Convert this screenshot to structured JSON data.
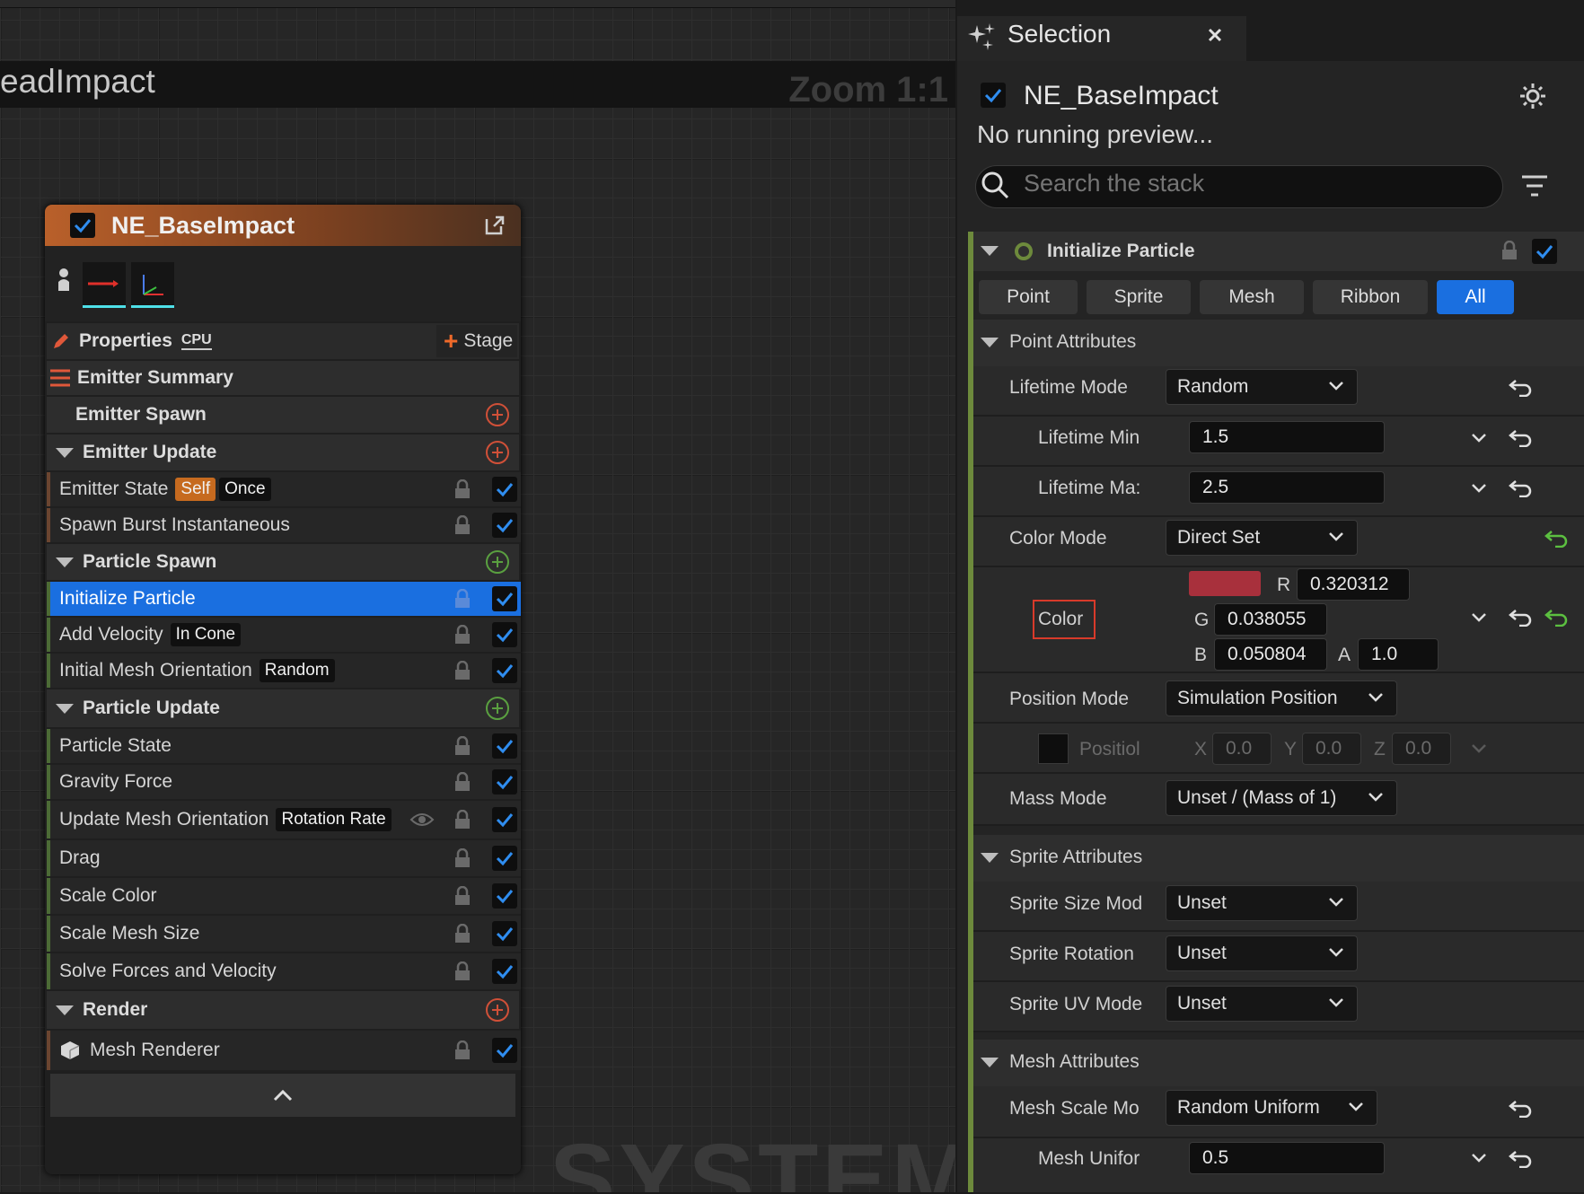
{
  "graph": {
    "title": "eadImpact",
    "zoom": "Zoom 1:1",
    "watermark": "SYSTEM"
  },
  "node": {
    "title": "NE_BaseImpact",
    "properties_label": "Properties",
    "cpu_label": "CPU",
    "stage_label": "Stage",
    "emitter_summary": "Emitter Summary",
    "sections": [
      {
        "label": "Emitter Spawn"
      },
      {
        "label": "Emitter Update"
      },
      {
        "label": "Particle Spawn"
      },
      {
        "label": "Particle Update"
      },
      {
        "label": "Render"
      }
    ],
    "items": [
      {
        "label": "Emitter State",
        "tag1": "Self",
        "tag2": "Once"
      },
      {
        "label": "Spawn Burst Instantaneous"
      },
      {
        "label": "Initialize Particle"
      },
      {
        "label": "Add Velocity",
        "tag1": "In Cone"
      },
      {
        "label": "Initial Mesh Orientation",
        "tag1": "Random"
      },
      {
        "label": "Particle State"
      },
      {
        "label": "Gravity Force"
      },
      {
        "label": "Update Mesh Orientation",
        "tag1": "Rotation Rate"
      },
      {
        "label": "Drag"
      },
      {
        "label": "Scale Color"
      },
      {
        "label": "Scale Mesh Size"
      },
      {
        "label": "Solve Forces and Velocity"
      },
      {
        "label": "Mesh Renderer"
      }
    ]
  },
  "panel": {
    "tab_label": "Selection",
    "system_name": "NE_BaseImpact",
    "preview_status": "No running preview...",
    "search_placeholder": "Search the stack",
    "module_title": "Initialize Particle",
    "filters": [
      "Point",
      "Sprite",
      "Mesh",
      "Ribbon",
      "All"
    ],
    "point_attributes": "Point Attributes",
    "lifetime_mode": {
      "label": "Lifetime Mode",
      "value": "Random"
    },
    "lifetime_min": {
      "label": "Lifetime Min",
      "value": "1.5"
    },
    "lifetime_max": {
      "label": "Lifetime Ma:",
      "value": "2.5"
    },
    "color_mode": {
      "label": "Color Mode",
      "value": "Direct Set"
    },
    "color": {
      "label": "Color",
      "r_label": "R",
      "r": "0.320312",
      "g_label": "G",
      "g": "0.038055",
      "b_label": "B",
      "b": "0.050804",
      "a_label": "A",
      "a": "1.0",
      "swatch": "#a8303c"
    },
    "position_mode": {
      "label": "Position Mode",
      "value": "Simulation Position"
    },
    "position": {
      "label": "Positiol",
      "x_label": "X",
      "x": "0.0",
      "y_label": "Y",
      "y": "0.0",
      "z_label": "Z",
      "z": "0.0"
    },
    "mass_mode": {
      "label": "Mass Mode",
      "value": "Unset / (Mass of 1)"
    },
    "sprite_attributes": "Sprite Attributes",
    "sprite_size_mode": {
      "label": "Sprite Size Mod",
      "value": "Unset"
    },
    "sprite_rotation": {
      "label": "Sprite Rotation",
      "value": "Unset"
    },
    "sprite_uv_mode": {
      "label": "Sprite UV Mode",
      "value": "Unset"
    },
    "mesh_attributes": "Mesh Attributes",
    "mesh_scale_mode": {
      "label": "Mesh Scale Mo",
      "value": "Random Uniform"
    },
    "mesh_uniform": {
      "label": "Mesh Unifor",
      "value": "0.5"
    }
  },
  "colors": {
    "accent": "#1a6fe0",
    "stack_bar": "#6d8a3c",
    "header_orange": "#b9602a"
  }
}
